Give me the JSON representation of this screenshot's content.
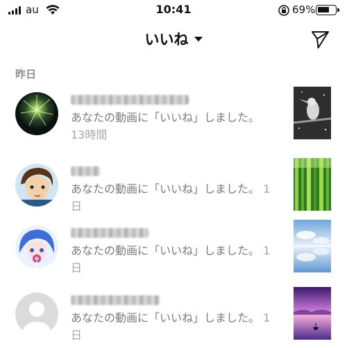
{
  "status_bar": {
    "carrier": "au",
    "time": "10:41",
    "battery_percent": "69%",
    "battery_level": 0.69,
    "icons": [
      "signal-bars-icon",
      "wifi-icon",
      "rotation-lock-icon",
      "battery-icon"
    ]
  },
  "header": {
    "title": "いいね",
    "dropdown_icon": "caret-down-icon",
    "action_icon": "send-paper-plane-icon"
  },
  "section": {
    "label": "昨日"
  },
  "notifications": [
    {
      "avatar_icon": "fireworks-avatar",
      "message": "あなたの動画に「いいね」しました。",
      "timestamp": "13時間",
      "thumbnail_icon": "bird-on-branch-thumbnail"
    },
    {
      "avatar_icon": "anime-character-avatar",
      "message": "あなたの動画に「いいね」しました。",
      "timestamp": "1日",
      "thumbnail_icon": "bamboo-forest-thumbnail"
    },
    {
      "avatar_icon": "anime-girl-avatar",
      "message": "あなたの動画に「いいね」しました。",
      "timestamp": "1日",
      "thumbnail_icon": "sky-reflection-thumbnail"
    },
    {
      "avatar_icon": "default-user-avatar",
      "message": "あなたの動画に「いいね」しました。",
      "timestamp": "1日",
      "thumbnail_icon": "purple-lake-thumbnail"
    }
  ],
  "colors": {
    "text_primary": "#111111",
    "text_secondary": "#7a7a7a",
    "timestamp": "#a6a6a6",
    "section_header": "#8e8e8e",
    "background": "#ffffff"
  }
}
